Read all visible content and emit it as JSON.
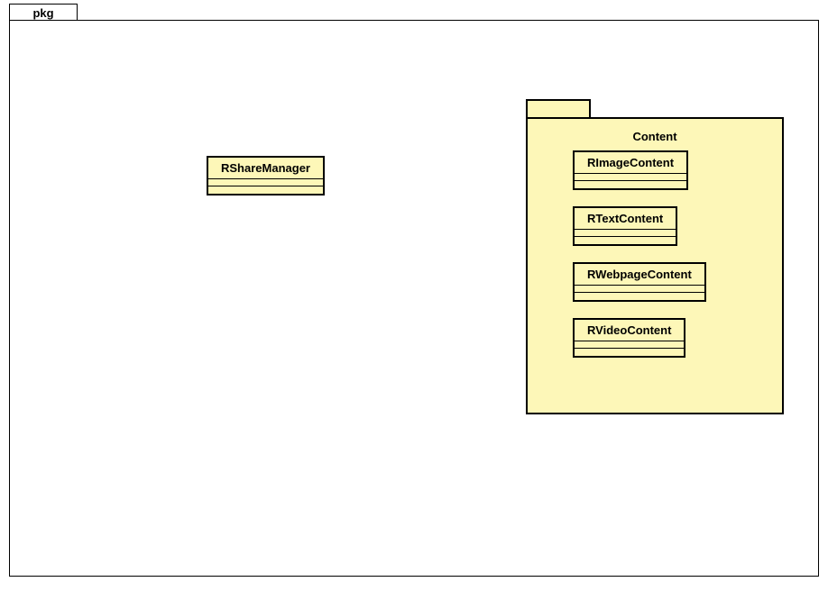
{
  "pkg_label": "pkg",
  "classes": {
    "share_manager": "RShareManager"
  },
  "package": {
    "title": "Content",
    "classes": {
      "image": "RImageContent",
      "text": "RTextContent",
      "webpage": "RWebpageContent",
      "video": "RVideoContent"
    }
  }
}
